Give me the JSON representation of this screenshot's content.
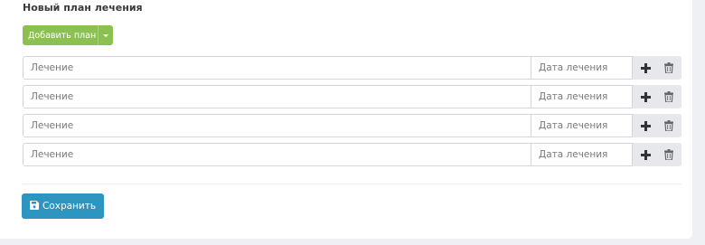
{
  "form": {
    "title": "Новый план лечения",
    "add_plan_label": "Добавить план",
    "rows": [
      {
        "treatment_placeholder": "Лечение",
        "date_placeholder": "Дата лечения"
      },
      {
        "treatment_placeholder": "Лечение",
        "date_placeholder": "Дата лечения"
      },
      {
        "treatment_placeholder": "Лечение",
        "date_placeholder": "Дата лечения"
      },
      {
        "treatment_placeholder": "Лечение",
        "date_placeholder": "Дата лечения"
      }
    ],
    "save_label": "Сохранить"
  },
  "icons": {
    "add": "plus-icon",
    "delete": "trash-icon",
    "save": "floppy-disk-icon",
    "dropdown": "caret-down-icon"
  },
  "colors": {
    "add_button": "#8cc152",
    "save_button": "#2e94c0",
    "actions_bg": "#e6e8eb"
  }
}
